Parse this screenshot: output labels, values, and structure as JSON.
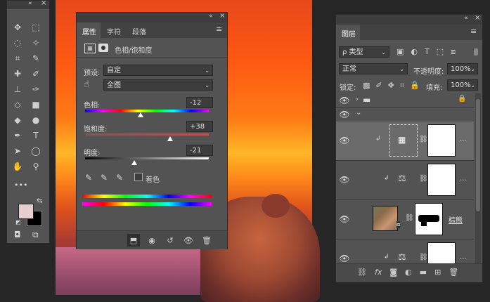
{
  "toolbar": {
    "top_arrows": "«",
    "top_close": "×",
    "extra": "•••"
  },
  "props": {
    "tabs": [
      "属性",
      "字符",
      "段落"
    ],
    "title": "色相/饱和度",
    "preset_label": "预设:",
    "preset_value": "自定",
    "range_value": "全图",
    "hue_label": "色相:",
    "hue_value": "-12",
    "sat_label": "饱和度:",
    "sat_value": "+38",
    "light_label": "明度:",
    "light_value": "-21",
    "colorize_label": "着色",
    "hue_pos": 0.45,
    "sat_pos": 0.69,
    "light_pos": 0.395
  },
  "layers": {
    "tab": "图层",
    "kind_label": "ρ 类型",
    "blend_mode": "正常",
    "opacity_label": "不透明度:",
    "opacity_value": "100%",
    "lock_label": "锁定:",
    "fill_label": "填充:",
    "fill_value": "100%",
    "layer_name": "棕熊",
    "more": "..."
  },
  "colors": {
    "foreground": "#e7cfcf",
    "background": "#000000"
  }
}
